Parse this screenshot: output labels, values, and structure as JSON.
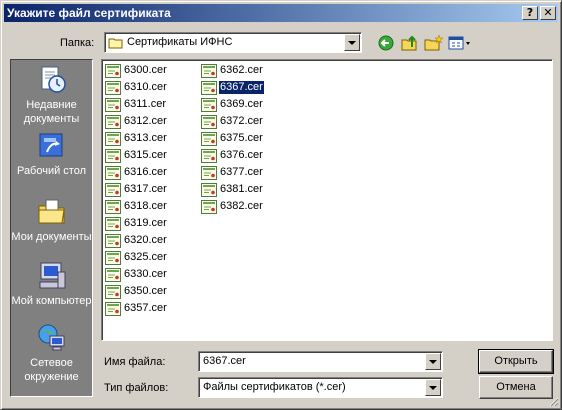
{
  "window": {
    "title": "Укажите файл сертификата",
    "help_button": "?",
    "close_button": "✕"
  },
  "location": {
    "label": "Папка:",
    "value": "Сертификаты ИФНС"
  },
  "places": [
    {
      "label": "Недавние документы",
      "icon": "recent-documents-icon"
    },
    {
      "label": "Рабочий стол",
      "icon": "desktop-icon"
    },
    {
      "label": "Мои документы",
      "icon": "my-documents-icon"
    },
    {
      "label": "Мой компьютер",
      "icon": "my-computer-icon"
    },
    {
      "label": "Сетевое окружение",
      "icon": "network-places-icon"
    }
  ],
  "files": {
    "column1": [
      "6300.cer",
      "6310.cer",
      "6311.cer",
      "6312.cer",
      "6313.cer",
      "6315.cer",
      "6316.cer",
      "6317.cer",
      "6318.cer",
      "6319.cer",
      "6320.cer",
      "6325.cer",
      "6330.cer",
      "6350.cer",
      "6357.cer"
    ],
    "column2": [
      "6362.cer",
      "6367.cer",
      "6369.cer",
      "6372.cer",
      "6375.cer",
      "6376.cer",
      "6377.cer",
      "6381.cer",
      "6382.cer"
    ],
    "selected": "6367.cer"
  },
  "filename": {
    "label": "Имя файла:",
    "value": "6367.cer"
  },
  "filetype": {
    "label": "Тип файлов:",
    "value": "Файлы сертификатов (*.cer)"
  },
  "buttons": {
    "open": "Открыть",
    "cancel": "Отмена"
  },
  "colors": {
    "title_start": "#0a246a",
    "title_end": "#a6caf0",
    "face": "#d4d0c8",
    "selection": "#0a246a"
  }
}
